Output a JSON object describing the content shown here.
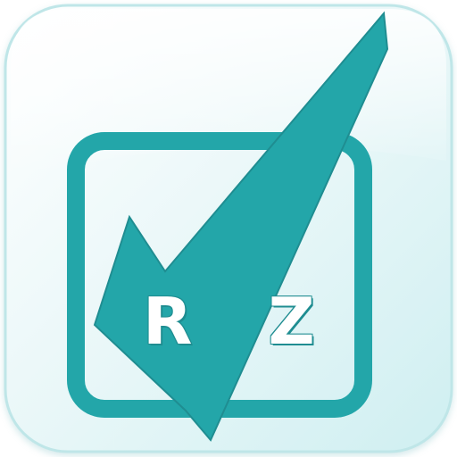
{
  "app_icon": {
    "text": "R Z",
    "colors": {
      "accent": "#23a6a9",
      "accent_dark": "#1f8d91",
      "tile_light": "#ffffff",
      "tile_mid": "#e9f7f8",
      "tile_dark": "#cfeff1",
      "text": "#ffffff"
    },
    "icons": {
      "tile": "rounded-square-icon",
      "frame": "checkbox-frame-icon",
      "check": "checkmark-icon"
    }
  }
}
